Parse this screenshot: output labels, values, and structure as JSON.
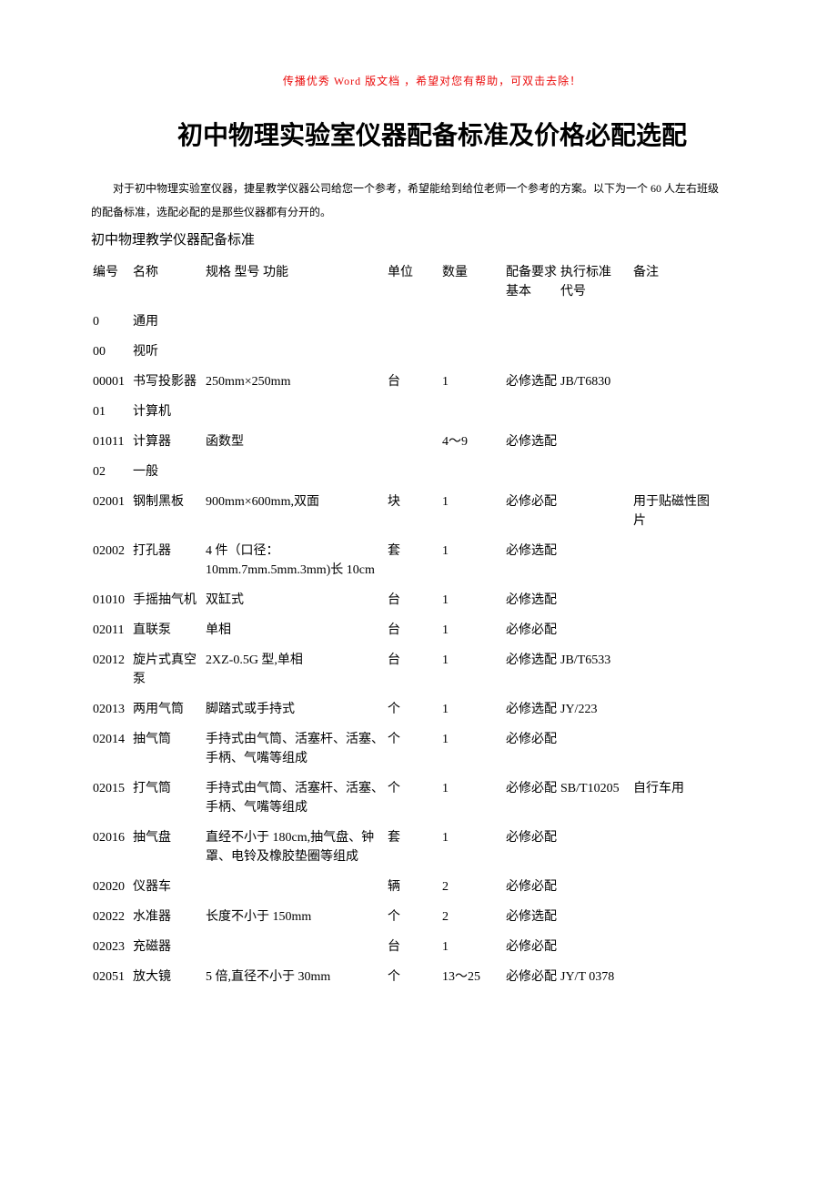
{
  "header_note": "传播优秀 Word 版文档 ，希望对您有帮助，可双击去除！",
  "title": "初中物理实验室仪器配备标准及价格必配选配",
  "intro_line1": "对于初中物理实验室仪器，捷星教学仪器公司给您一个参考，希望能给到给位老师一个参考的方案。以下为一个 60 人左右班级",
  "intro_line2": "的配备标准，选配必配的是那些仪器都有分开的。",
  "subtitle": "初中物理教学仪器配备标准",
  "headers": {
    "col1": "编号",
    "col2": "名称",
    "col3": "规格 型号 功能",
    "col4": "单位",
    "col5": "数量",
    "col6": "配备要求",
    "col6b": "基本",
    "col7": "执行标准",
    "col7b": "代号",
    "col8": "备注"
  },
  "rows": [
    {
      "id": "0",
      "name": "通用",
      "spec": "",
      "unit": "",
      "qty": "",
      "req": "",
      "std": "",
      "note": ""
    },
    {
      "id": "00",
      "name": "视听",
      "spec": "",
      "unit": "",
      "qty": "",
      "req": "",
      "std": "",
      "note": ""
    },
    {
      "id": "00001",
      "name": "书写投影器",
      "spec": "250mm×250mm",
      "unit": "台",
      "qty": "1",
      "req": "必修选配",
      "std": "JB/T6830",
      "note": ""
    },
    {
      "id": "01",
      "name": "计算机",
      "spec": "",
      "unit": "",
      "qty": "",
      "req": "",
      "std": "",
      "note": ""
    },
    {
      "id": "01011",
      "name": "计算器",
      "spec": "函数型",
      "unit": "",
      "qty": "4～9",
      "req": "必修选配",
      "std": "",
      "note": ""
    },
    {
      "id": "02",
      "name": "一般",
      "spec": "",
      "unit": "",
      "qty": "",
      "req": "",
      "std": "",
      "note": ""
    },
    {
      "id": "02001",
      "name": "钢制黑板",
      "spec": "900mm×600mm,双面",
      "unit": "块",
      "qty": "1",
      "req": "必修必配",
      "std": "",
      "note": "用于贴磁性图片"
    },
    {
      "id": "02002",
      "name": "打孔器",
      "spec": "4 件（口径：10mm.7mm.5mm.3mm)长 10cm",
      "unit": "套",
      "qty": "1",
      "req": "必修选配",
      "std": "",
      "note": ""
    },
    {
      "id": "01010",
      "name": "手摇抽气机",
      "spec": "双缸式",
      "unit": "台",
      "qty": "1",
      "req": "必修选配",
      "std": "",
      "note": ""
    },
    {
      "id": "02011",
      "name": "直联泵",
      "spec": "单相",
      "unit": "台",
      "qty": "1",
      "req": "必修必配",
      "std": "",
      "note": ""
    },
    {
      "id": "02012",
      "name": "旋片式真空泵",
      "spec": "2XZ-0.5G 型,单相",
      "unit": "台",
      "qty": "1",
      "req": "必修选配",
      "std": "JB/T6533",
      "note": ""
    },
    {
      "id": "02013",
      "name": "两用气筒",
      "spec": "脚踏式或手持式",
      "unit": "个",
      "qty": "1",
      "req": "必修选配",
      "std": "JY/223",
      "note": ""
    },
    {
      "id": "02014",
      "name": "抽气筒",
      "spec": "手持式由气筒、活塞杆、活塞、手柄、气嘴等组成",
      "unit": "个",
      "qty": "1",
      "req": "必修必配",
      "std": "",
      "note": ""
    },
    {
      "id": "02015",
      "name": "打气筒",
      "spec": "手持式由气筒、活塞杆、活塞、手柄、气嘴等组成",
      "unit": "个",
      "qty": "1",
      "req": "必修必配",
      "std": "SB/T10205",
      "note": "自行车用"
    },
    {
      "id": "02016",
      "name": "抽气盘",
      "spec": "直经不小于 180cm,抽气盘、钟罩、电铃及橡胶垫圈等组成",
      "unit": "套",
      "qty": "1",
      "req": "必修必配",
      "std": "",
      "note": ""
    },
    {
      "id": "02020",
      "name": "仪器车",
      "spec": "",
      "unit": "辆",
      "qty": "2",
      "req": "必修必配",
      "std": "",
      "note": ""
    },
    {
      "id": "02022",
      "name": "水准器",
      "spec": "长度不小于 150mm",
      "unit": "个",
      "qty": "2",
      "req": "必修选配",
      "std": "",
      "note": ""
    },
    {
      "id": "02023",
      "name": "充磁器",
      "spec": "",
      "unit": "台",
      "qty": "1",
      "req": "必修必配",
      "std": "",
      "note": ""
    },
    {
      "id": "02051",
      "name": "放大镜",
      "spec": "5 倍,直径不小于 30mm",
      "unit": "个",
      "qty": "13～25",
      "req": "必修必配",
      "std": "JY/T 0378",
      "note": ""
    }
  ]
}
